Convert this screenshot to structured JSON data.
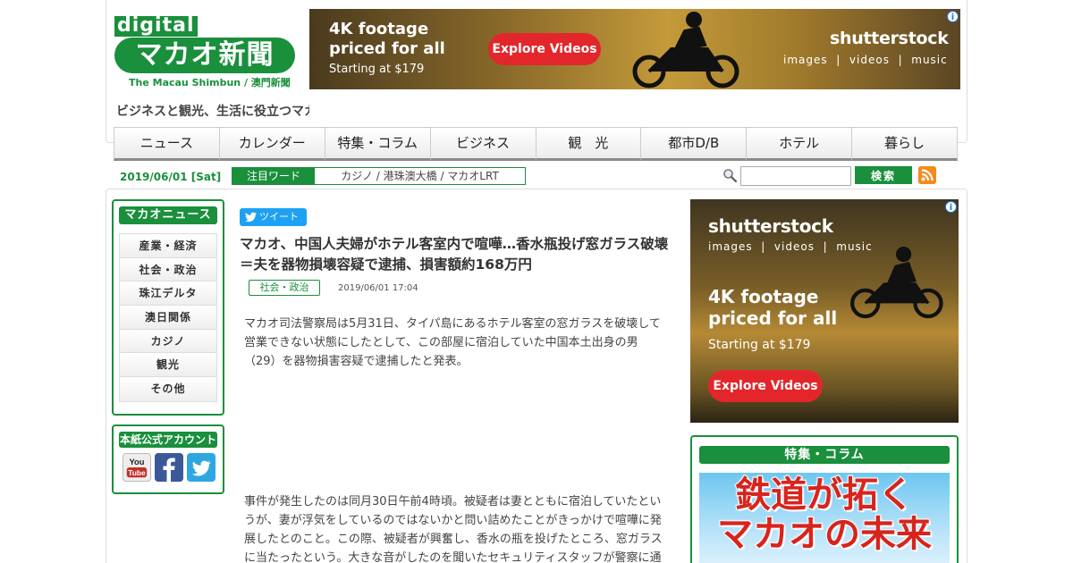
{
  "site": {
    "logo_digital": "digital",
    "logo_main": "マカオ新聞",
    "logo_sub": "The Macau Shimbun / 澳門新聞",
    "tagline": "ビジネスと観光、生活に役立つマカオ"
  },
  "top_ad": {
    "headline": "4K footage priced for all",
    "subline": "Starting at $179",
    "button": "Explore Videos",
    "brand": "shutterstock",
    "brand_sub": "images  |  videos  |  music",
    "info": "ⓘ"
  },
  "nav": {
    "items": [
      "ニュース",
      "カレンダー",
      "特集・コラム",
      "ビジネス",
      "観　光",
      "都市D/B",
      "ホテル",
      "暮らし"
    ]
  },
  "subbar": {
    "date": "2019/06/01 [Sat]",
    "hot_label": "注目ワード",
    "hot_words": "カジノ / 港珠澳大橋 / マカオLRT",
    "search_placeholder": "",
    "search_button": "検索"
  },
  "sidebar": {
    "news_title": "マカオニュース",
    "categories": [
      "産業・経済",
      "社会・政治",
      "珠江デルタ",
      "澳日関係",
      "カジノ",
      "観光",
      "その他"
    ],
    "account_title": "本紙公式アカウント",
    "youtube_label": "You Tube"
  },
  "article": {
    "tweet": "ツイート",
    "title": "マカオ、中国人夫婦がホテル客室内で喧嘩…香水瓶投げ窓ガラス破壊＝夫を器物損壊容疑で逮捕、損害額約168万円",
    "category": "社会・政治",
    "timestamp": "2019/06/01 17:04",
    "para1": "マカオ司法警察局は5月31日、タイパ島にあるホテル客室の窓ガラスを破壊して営業できない状態にしたとして、この部屋に宿泊していた中国本土出身の男（29）を器物損害容疑で逮捕したと発表。",
    "para2": "事件が発生したのは同月30日午前4時頃。被疑者は妻とともに宿泊していたというが、妻が浮気をしているのではないかと問い詰めたことがきっかけで喧嘩に発展したとのこと。この際、被疑者が興奮し、香水の瓶を投げたところ、窓ガラスに当たったという。大きな音がしたのを聞いたセキュリティスタッフが警察に通"
  },
  "side_ad": {
    "brand": "shutterstock",
    "brand_sub": "images  |  videos  |  music",
    "headline": "4K footage priced for all",
    "subline": "Starting at $179",
    "button": "Explore Videos",
    "info": "ⓘ"
  },
  "feature": {
    "title": "特集・コラム",
    "line1": "鉄道が拓く",
    "line2": "マカオの未来"
  },
  "colors": {
    "brand_green": "#1a8f3c",
    "ad_red": "#e3262b",
    "twitter_blue": "#1da1f2",
    "rss_orange": "#f38b1d"
  },
  "icons": [
    "search-icon",
    "rss-icon",
    "youtube-icon",
    "facebook-icon",
    "twitter-icon",
    "info-icon"
  ]
}
